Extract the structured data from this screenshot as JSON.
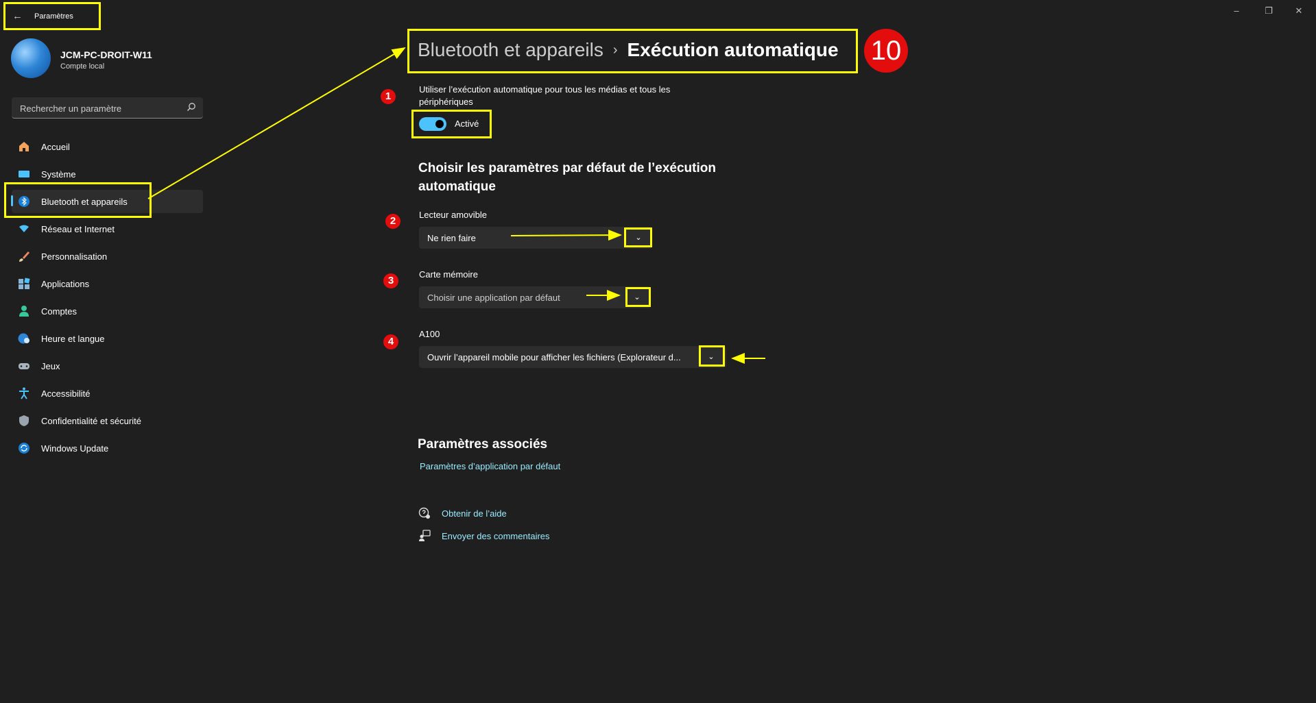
{
  "window": {
    "title": "Paramètres",
    "controls": {
      "minimize": "–",
      "maximize": "❐",
      "close": "✕"
    }
  },
  "profile": {
    "name": "JCM-PC-DROIT-W11",
    "account_type": "Compte local"
  },
  "search": {
    "placeholder": "Rechercher un paramètre"
  },
  "sidebar": {
    "items": [
      {
        "label": "Accueil",
        "icon": "home-icon"
      },
      {
        "label": "Système",
        "icon": "system-icon"
      },
      {
        "label": "Bluetooth et appareils",
        "icon": "bluetooth-icon",
        "selected": true
      },
      {
        "label": "Réseau et Internet",
        "icon": "wifi-icon"
      },
      {
        "label": "Personnalisation",
        "icon": "brush-icon"
      },
      {
        "label": "Applications",
        "icon": "apps-icon"
      },
      {
        "label": "Comptes",
        "icon": "person-icon"
      },
      {
        "label": "Heure et langue",
        "icon": "clock-globe-icon"
      },
      {
        "label": "Jeux",
        "icon": "gamepad-icon"
      },
      {
        "label": "Accessibilité",
        "icon": "accessibility-icon"
      },
      {
        "label": "Confidentialité et sécurité",
        "icon": "shield-icon"
      },
      {
        "label": "Windows Update",
        "icon": "update-icon"
      }
    ]
  },
  "breadcrumb": {
    "parent": "Bluetooth et appareils",
    "separator": "›",
    "current": "Exécution automatique"
  },
  "annotations": {
    "badge_10": "10",
    "badge_1": "1",
    "badge_2": "2",
    "badge_3": "3",
    "badge_4": "4",
    "highlight_color": "#ffff00",
    "badge_color": "#e30d0d"
  },
  "autoplay": {
    "description": "Utiliser l’exécution automatique pour tous les médias et tous les périphériques",
    "toggle_state": "Activé",
    "toggle_on": true
  },
  "defaults": {
    "heading": "Choisir les paramètres par défaut de l’exécution automatique",
    "removable": {
      "label": "Lecteur amovible",
      "value": "Ne rien faire"
    },
    "memory_card": {
      "label": "Carte mémoire",
      "value": "Choisir une application par défaut"
    },
    "device": {
      "label": "A100",
      "value": "Ouvrir l’appareil mobile pour afficher les fichiers (Explorateur d..."
    }
  },
  "related": {
    "heading": "Paramètres associés",
    "default_apps_link": "Paramètres d’application par défaut"
  },
  "help": {
    "get_help": "Obtenir de l’aide",
    "feedback": "Envoyer des commentaires"
  },
  "colors": {
    "accent": "#4cc2ff",
    "link": "#99ebff",
    "background": "#1f1f1f"
  }
}
